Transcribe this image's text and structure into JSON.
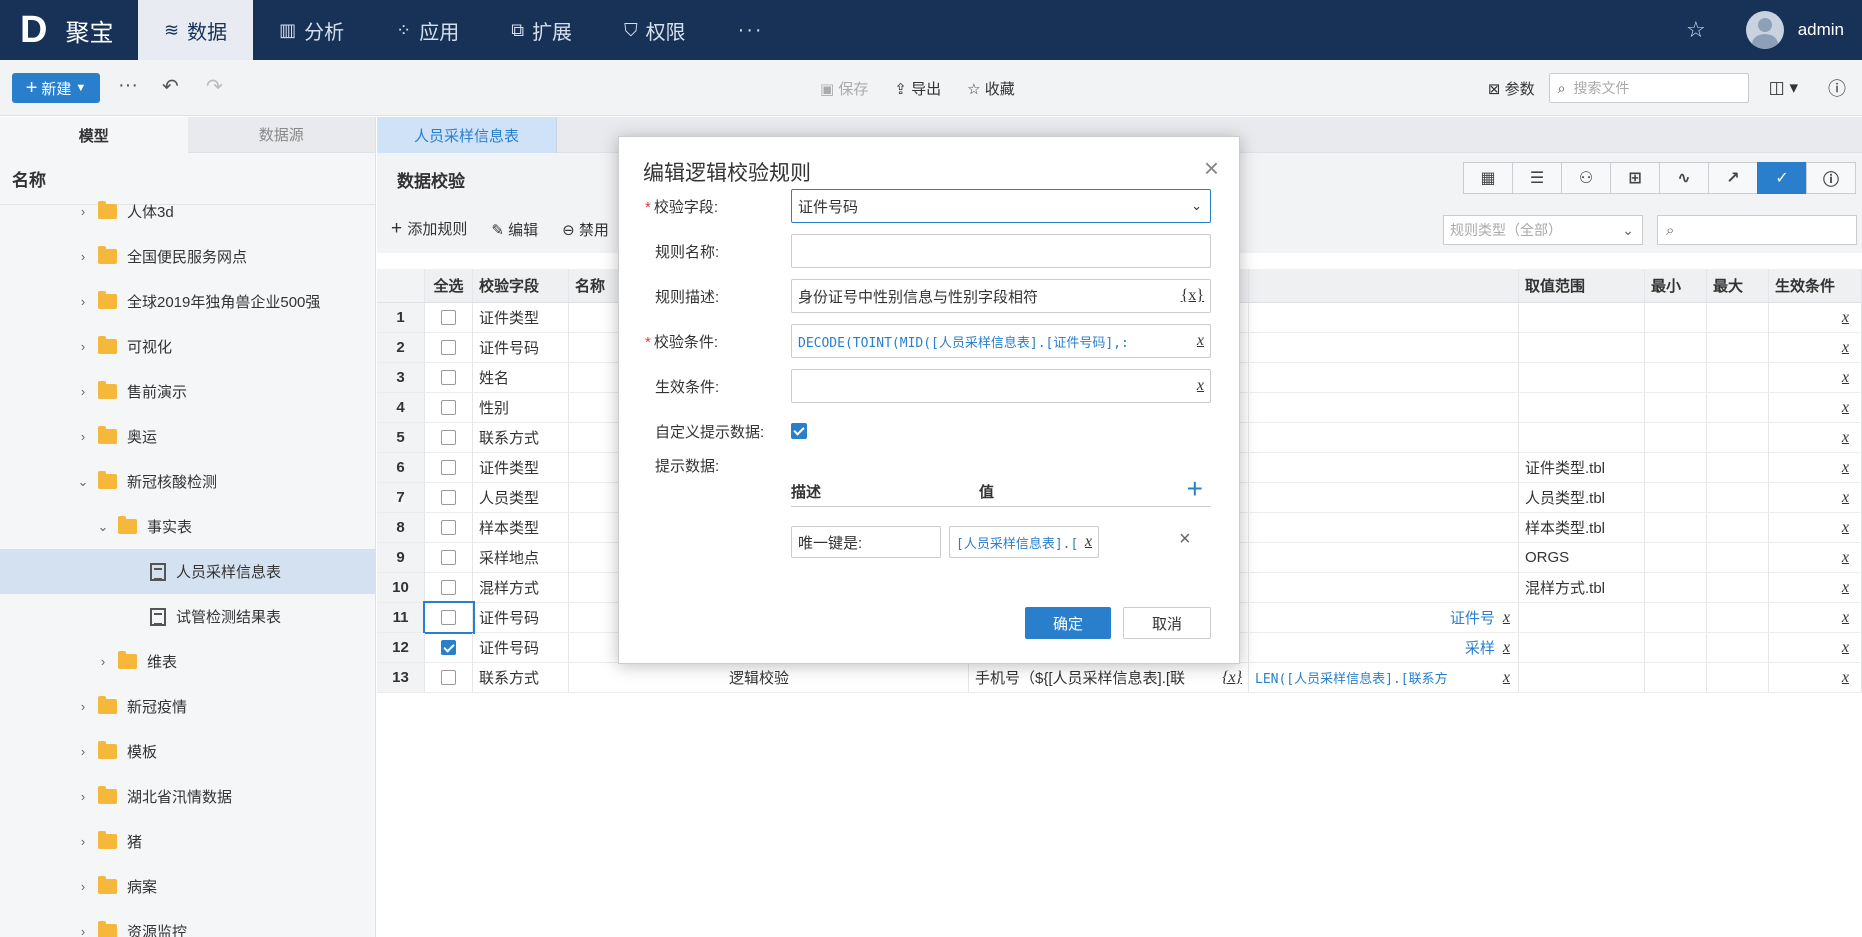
{
  "app": {
    "logo_mark": "D",
    "logo_text": "聚宝",
    "user": "admin"
  },
  "nav": [
    {
      "label": "数据",
      "icon": "database-icon"
    },
    {
      "label": "分析",
      "icon": "bar-chart-icon"
    },
    {
      "label": "应用",
      "icon": "apps-icon"
    },
    {
      "label": "扩展",
      "icon": "extension-icon"
    },
    {
      "label": "权限",
      "icon": "shield-icon"
    }
  ],
  "nav_more": "···",
  "toolbar": {
    "new_label": "新建",
    "save_label": "保存",
    "export_label": "导出",
    "favorite_label": "收藏",
    "params_label": "参数",
    "search_placeholder": "搜索文件"
  },
  "left": {
    "tabs": [
      "模型",
      "数据源"
    ],
    "title": "名称",
    "tree": [
      {
        "label": "人体3d",
        "type": "folder",
        "level": 0
      },
      {
        "label": "全国便民服务网点",
        "type": "folder",
        "level": 0
      },
      {
        "label": "全球2019年独角兽企业500强",
        "type": "folder",
        "level": 0
      },
      {
        "label": "可视化",
        "type": "folder",
        "level": 0
      },
      {
        "label": "售前演示",
        "type": "folder",
        "level": 0
      },
      {
        "label": "奥运",
        "type": "folder",
        "level": 0
      },
      {
        "label": "新冠核酸检测",
        "type": "folder",
        "level": 0,
        "expanded": true
      },
      {
        "label": "事实表",
        "type": "folder",
        "level": 1,
        "expanded": true
      },
      {
        "label": "人员采样信息表",
        "type": "table",
        "level": 2,
        "selected": true
      },
      {
        "label": "试管检测结果表",
        "type": "table",
        "level": 2
      },
      {
        "label": "维表",
        "type": "folder",
        "level": 1
      },
      {
        "label": "新冠疫情",
        "type": "folder",
        "level": 0
      },
      {
        "label": "模板",
        "type": "folder",
        "level": 0
      },
      {
        "label": "湖北省汛情数据",
        "type": "folder",
        "level": 0
      },
      {
        "label": "猪",
        "type": "folder",
        "level": 0
      },
      {
        "label": "病案",
        "type": "folder",
        "level": 0
      },
      {
        "label": "资源监控",
        "type": "folder",
        "level": 0
      }
    ]
  },
  "main": {
    "tab": "人员采样信息表",
    "title": "数据校验",
    "tools": {
      "add": "添加规则",
      "edit": "编辑",
      "disable": "禁用"
    },
    "rule_type_placeholder": "规则类型（全部）",
    "columns": {
      "all": "全选",
      "field": "校验字段",
      "name": "名称",
      "range": "取值范围",
      "min": "最小",
      "max": "最大",
      "effect": "生效条件"
    },
    "rows": [
      {
        "n": "1",
        "field": "证件类型",
        "checked": false,
        "kind": "",
        "expr": "",
        "cond": "",
        "range": ""
      },
      {
        "n": "2",
        "field": "证件号码",
        "checked": false,
        "kind": "",
        "expr": "",
        "cond": "",
        "range": ""
      },
      {
        "n": "3",
        "field": "姓名",
        "checked": false,
        "kind": "",
        "expr": "",
        "cond": "",
        "range": ""
      },
      {
        "n": "4",
        "field": "性别",
        "checked": false,
        "kind": "",
        "expr": "",
        "cond": "",
        "range": ""
      },
      {
        "n": "5",
        "field": "联系方式",
        "checked": false,
        "kind": "",
        "expr": "",
        "cond": "",
        "range": ""
      },
      {
        "n": "6",
        "field": "证件类型",
        "checked": false,
        "kind": "",
        "expr": "",
        "cond": "",
        "range": "证件类型.tbl"
      },
      {
        "n": "7",
        "field": "人员类型",
        "checked": false,
        "kind": "",
        "expr": "",
        "cond": "",
        "range": "人员类型.tbl"
      },
      {
        "n": "8",
        "field": "样本类型",
        "checked": false,
        "kind": "",
        "expr": "",
        "cond": "",
        "range": "样本类型.tbl"
      },
      {
        "n": "9",
        "field": "采样地点",
        "checked": false,
        "kind": "",
        "expr": "",
        "cond": "",
        "range": "ORGS"
      },
      {
        "n": "10",
        "field": "混样方式",
        "checked": false,
        "kind": "",
        "expr": "",
        "cond": "",
        "range": "混样方式.tbl"
      },
      {
        "n": "11",
        "field": "证件号码",
        "checked": false,
        "kind": "",
        "expr": "",
        "cond": "证件号",
        "range": ""
      },
      {
        "n": "12",
        "field": "证件号码",
        "checked": true,
        "kind": "",
        "expr": "",
        "cond": "采样",
        "range": ""
      },
      {
        "n": "13",
        "field": "联系方式",
        "checked": false,
        "kind": "逻辑校验",
        "expr": "手机号（${[人员采样信息表].[联",
        "cond": "LEN([人员采样信息表].[联系方",
        "range": ""
      }
    ]
  },
  "dialog": {
    "title": "编辑逻辑校验规则",
    "field_label": "校验字段:",
    "field_value": "证件号码",
    "name_label": "规则名称:",
    "name_value": "",
    "desc_label": "规则描述:",
    "desc_value": "身份证号中性别信息与性别字段相符",
    "desc_suffix": "{x}",
    "cond_label": "校验条件:",
    "cond_value": "DECODE(TOINT(MID([人员采样信息表].[证件号码],:",
    "effect_label": "生效条件:",
    "effect_value": "",
    "custom_hint_label": "自定义提示数据:",
    "hint_label": "提示数据:",
    "hint_col_desc": "描述",
    "hint_col_value": "值",
    "hint_rows": [
      {
        "desc": "唯一键是:",
        "value": "[人员采样信息表].["
      }
    ],
    "ok": "确定",
    "cancel": "取消"
  }
}
